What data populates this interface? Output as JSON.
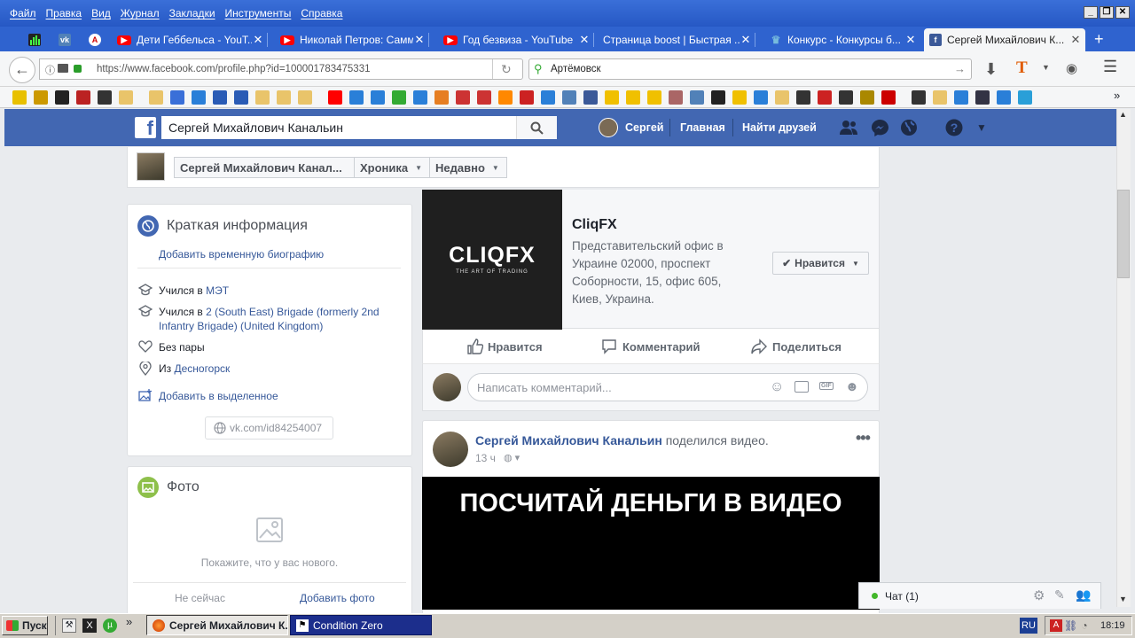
{
  "menu": [
    "Файл",
    "Правка",
    "Вид",
    "Журнал",
    "Закладки",
    "Инструменты",
    "Справка"
  ],
  "tabs": [
    {
      "title": "Дети Геббельса - YouT...",
      "fav": "youtube"
    },
    {
      "title": "Николай Петров: Самм...",
      "fav": "youtube"
    },
    {
      "title": "Год безвиза - YouTube",
      "fav": "youtube"
    },
    {
      "title": "Страница boost | Быстрая ...",
      "fav": "none"
    },
    {
      "title": "Конкурс - Конкурсы б...",
      "fav": "crown"
    },
    {
      "title": "Сергей Михайлович К...",
      "fav": "facebook"
    }
  ],
  "nav": {
    "url": "https://www.facebook.com/profile.php?id=100001783475331",
    "search": "Артёмовск"
  },
  "fb": {
    "search_value": "Сергей Михайлович Канальин",
    "user": "Сергей",
    "home": "Главная",
    "find_friends": "Найти друзей",
    "brand_color": "#4267b2"
  },
  "subheader": {
    "name": "Сергей Михайлович Канал...",
    "timeline": "Хроника",
    "recent": "Недавно"
  },
  "intro": {
    "title": "Краткая информация",
    "add_bio": "Добавить временную биографию",
    "studied1_prefix": "Учился в ",
    "studied1_link": "МЭТ",
    "studied2_prefix": "Учился в ",
    "studied2_link": "2 (South East) Brigade (formerly 2nd Infantry Brigade) (United Kingdom)",
    "relationship": "Без пары",
    "from_prefix": "Из ",
    "from_link": "Десногорск",
    "add_featured": "Добавить в выделенное",
    "vk_link": "vk.com/id84254007"
  },
  "photos": {
    "title": "Фото",
    "prompt": "Покажите, что у вас нового.",
    "not_now": "Не сейчас",
    "add_photo": "Добавить фото"
  },
  "page_post": {
    "logo_text": "CLIQFX",
    "logo_tagline": "THE ART OF TRADING",
    "name": "CliqFX",
    "address": "Представительский офис в Украине 02000, проспект Соборности, 15, офис 605, Киев, Украина.",
    "like_button": "Нравится",
    "like": "Нравится",
    "comment": "Комментарий",
    "share": "Поделиться",
    "comment_placeholder": "Написать комментарий..."
  },
  "video_post": {
    "author": "Сергей Михайлович Канальин",
    "action": " поделился видео.",
    "time": "13 ч",
    "video_title": "ПОСЧИТАЙ ДЕНЬГИ В ВИДЕО"
  },
  "chat": {
    "label": "Чат (1)"
  },
  "taskbar": {
    "start": "Пуск",
    "task1": "Сергей Михайлович К...",
    "task2": "Condition Zero",
    "lang": "RU",
    "clock": "18:19"
  }
}
